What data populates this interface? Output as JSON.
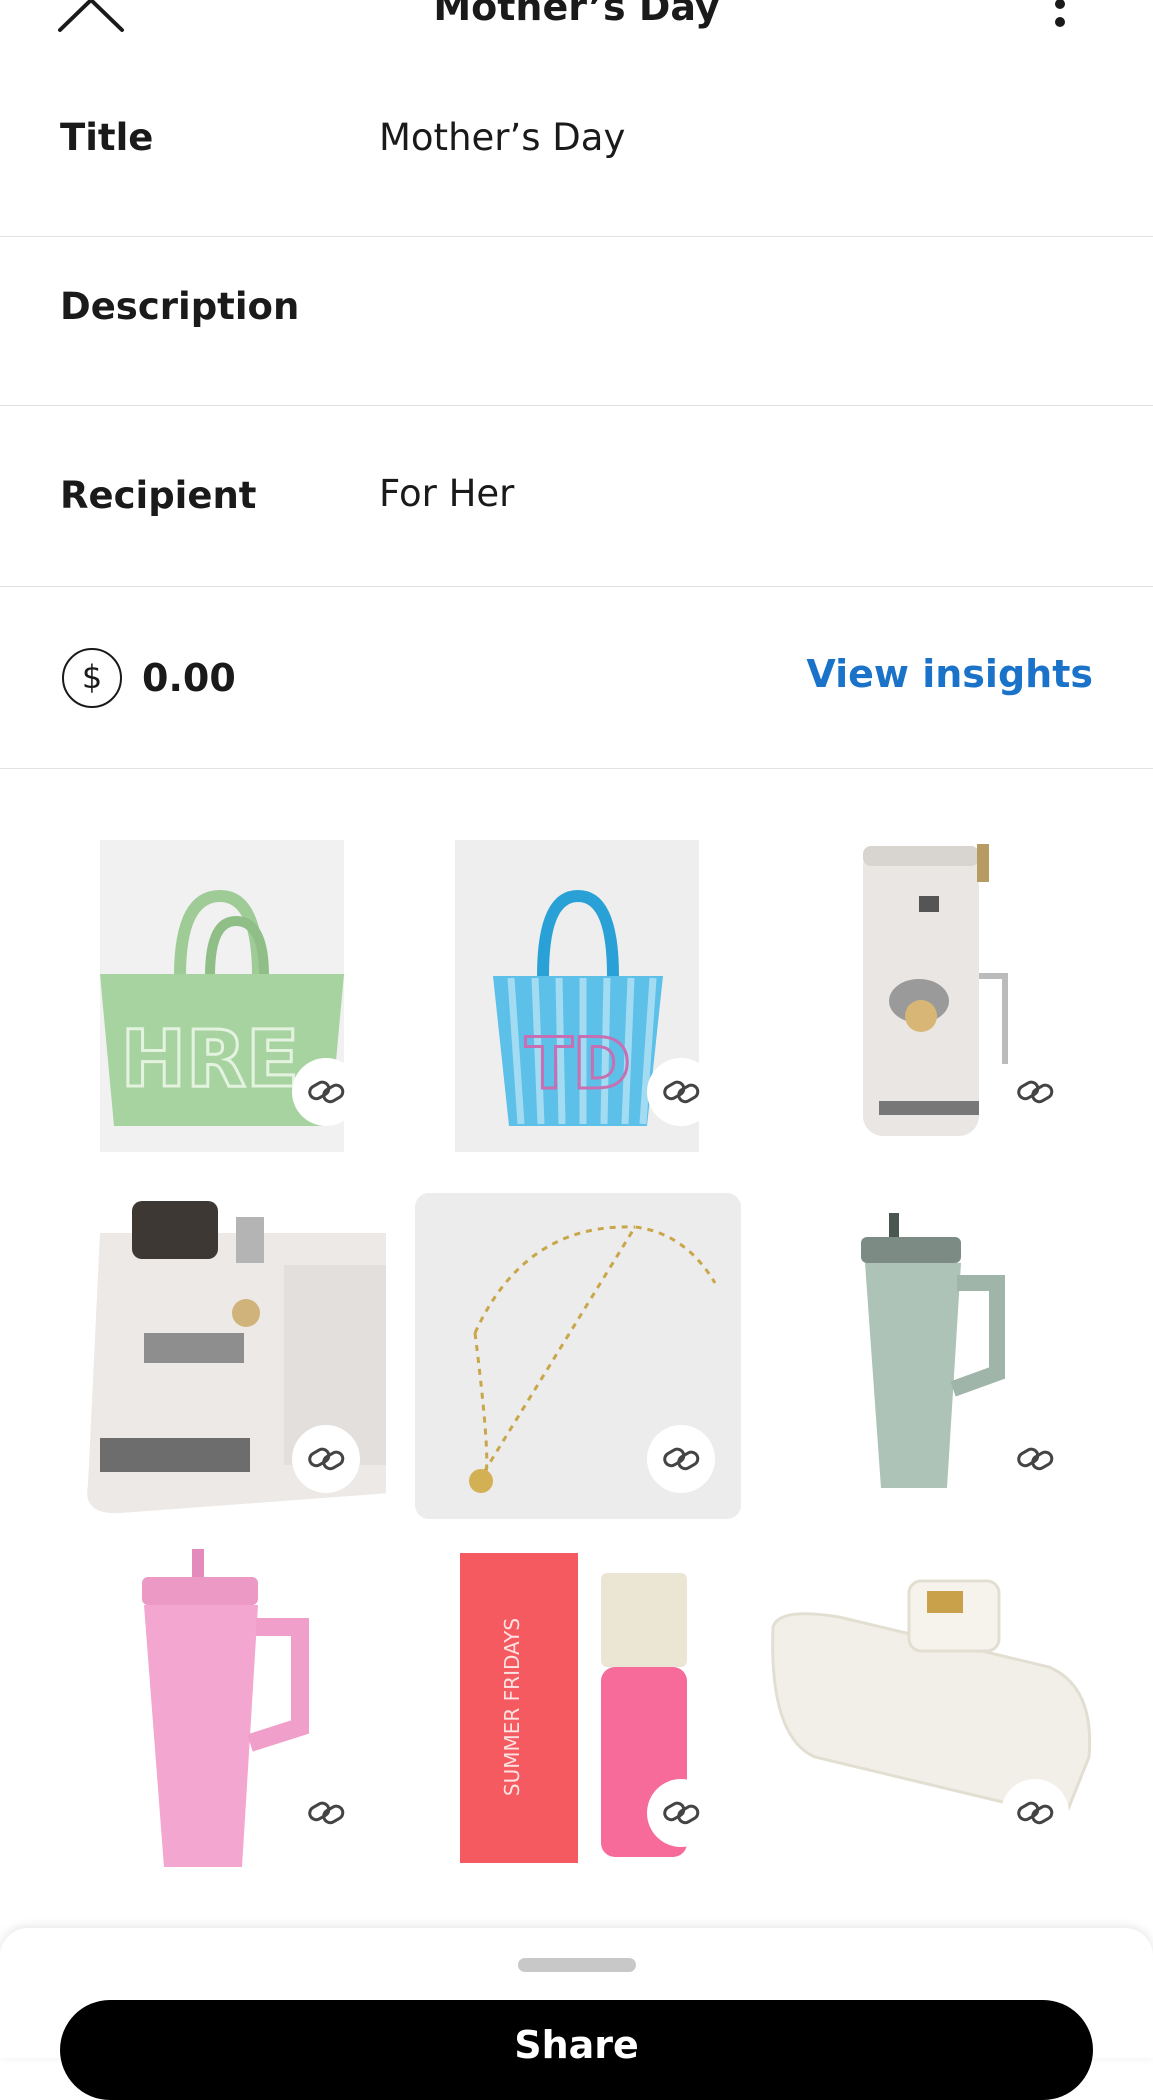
{
  "header": {
    "title": "Mother’s Day"
  },
  "form": {
    "title_label": "Title",
    "title_value": "Mother’s Day",
    "description_label": "Description",
    "recipient_label": "Recipient",
    "recipient_value": "For Her"
  },
  "price": {
    "value": "0.00",
    "insights_label": "View insights"
  },
  "products": [
    {
      "name": "green tote bag",
      "print": "HRE"
    },
    {
      "name": "blue striped tote bag",
      "print": "TD"
    },
    {
      "name": "espresso machine"
    },
    {
      "name": "espresso machine with grinder"
    },
    {
      "name": "gold necklace"
    },
    {
      "name": "sage tumbler"
    },
    {
      "name": "pink tumbler"
    },
    {
      "name": "lip oil",
      "box_text": "SUMMER FRIDAYS"
    },
    {
      "name": "claw clip"
    }
  ],
  "bottom_sheet": {
    "share_label": "Share"
  },
  "colors": {
    "accent": "#1a73c9",
    "selected_tile": "#ececec"
  }
}
